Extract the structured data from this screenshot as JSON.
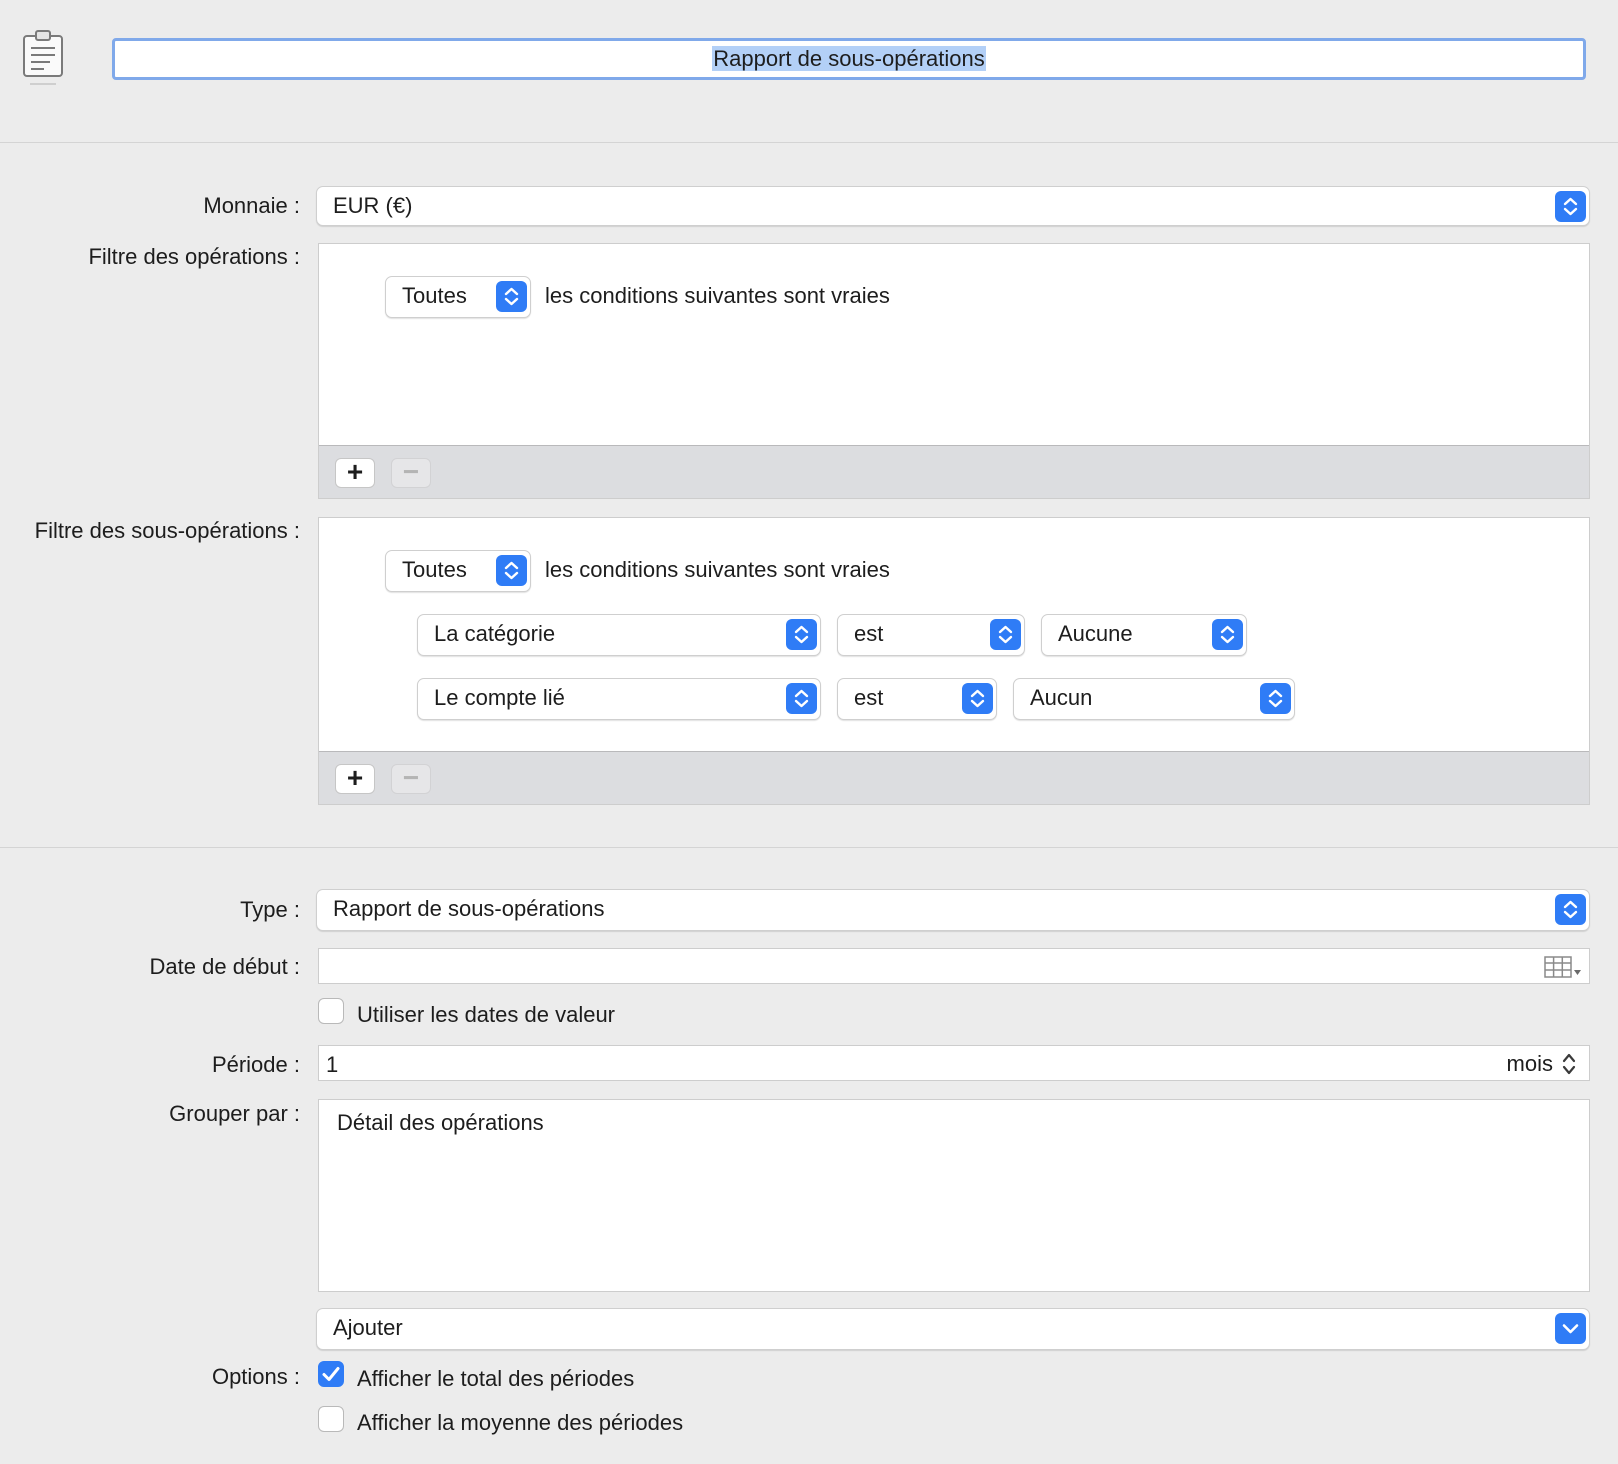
{
  "header": {
    "title_value": "Rapport de sous-opérations"
  },
  "currency": {
    "label": "Monnaie :",
    "value": "EUR (€)"
  },
  "transaction_filter": {
    "label": "Filtre des opérations :",
    "match_value": "Toutes",
    "match_suffix": "les conditions suivantes sont vraies",
    "add_label": "+",
    "remove_label": "−"
  },
  "split_filter": {
    "label": "Filtre des sous-opérations :",
    "match_value": "Toutes",
    "match_suffix": "les conditions suivantes sont vraies",
    "rules": [
      {
        "field": "La catégorie",
        "operator": "est",
        "value": "Aucune"
      },
      {
        "field": "Le compte lié",
        "operator": "est",
        "value": "Aucun"
      }
    ],
    "add_label": "+",
    "remove_label": "−"
  },
  "report": {
    "type_label": "Type :",
    "type_value": "Rapport de sous-opérations",
    "start_date_label": "Date de début :",
    "start_date_value": "",
    "use_value_dates_label": "Utiliser les dates de valeur",
    "use_value_dates_checked": false,
    "period_label": "Période :",
    "period_value": "1",
    "period_unit": "mois",
    "group_by_label": "Grouper par :",
    "group_by_items": [
      "Détail des opérations"
    ],
    "add_group_value": "Ajouter",
    "options_label": "Options :",
    "show_total_label": "Afficher le total des périodes",
    "show_total_checked": true,
    "show_average_label": "Afficher la moyenne des périodes",
    "show_average_checked": false
  },
  "colors": {
    "accent": "#2f7cf6",
    "background": "#ececec",
    "focus_ring": "#80a9ea"
  }
}
